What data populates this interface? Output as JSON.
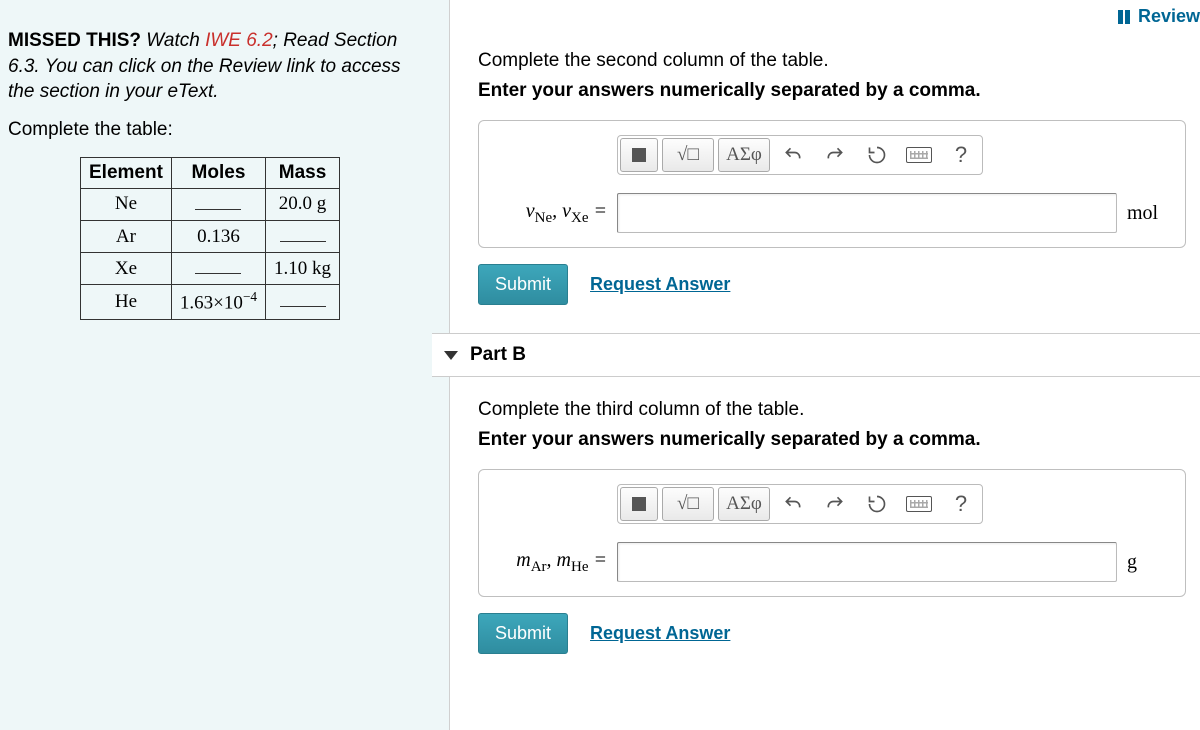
{
  "header": {
    "review": "Review"
  },
  "left": {
    "missed_bold": "MISSED THIS?",
    "missed_watch": " Watch ",
    "missed_link": "IWE 6.2",
    "missed_rest": "; Read Section 6.3. You can click on the Review link to access the section in your eText.",
    "complete": "Complete the table:",
    "table": {
      "h1": "Element",
      "h2": "Moles",
      "h3": "Mass",
      "rows": [
        {
          "el": "Ne",
          "moles": "",
          "mass": "20.0 g"
        },
        {
          "el": "Ar",
          "moles": "0.136",
          "mass": ""
        },
        {
          "el": "Xe",
          "moles": "",
          "mass": "1.10 kg"
        },
        {
          "el": "He",
          "moles": "1.63×10",
          "moles_sup": "−4",
          "mass": ""
        }
      ]
    }
  },
  "toolbar": {
    "greek": "ΑΣφ",
    "help": "?"
  },
  "partA": {
    "instr": "Complete the second column of the table.",
    "instr2": "Enter your answers numerically separated by a comma.",
    "label_html": "ν<sub class='sub'>Ne</sub>, ν<sub class='sub'>Xe</sub> =",
    "unit": "mol",
    "submit": "Submit",
    "request": "Request Answer"
  },
  "partB": {
    "title": "Part B",
    "instr": "Complete the third column of the table.",
    "instr2": "Enter your answers numerically separated by a comma.",
    "label_html": "m<sub class='sub'>Ar</sub>, m<sub class='sub'>He</sub> =",
    "unit": "g",
    "submit": "Submit",
    "request": "Request Answer"
  }
}
